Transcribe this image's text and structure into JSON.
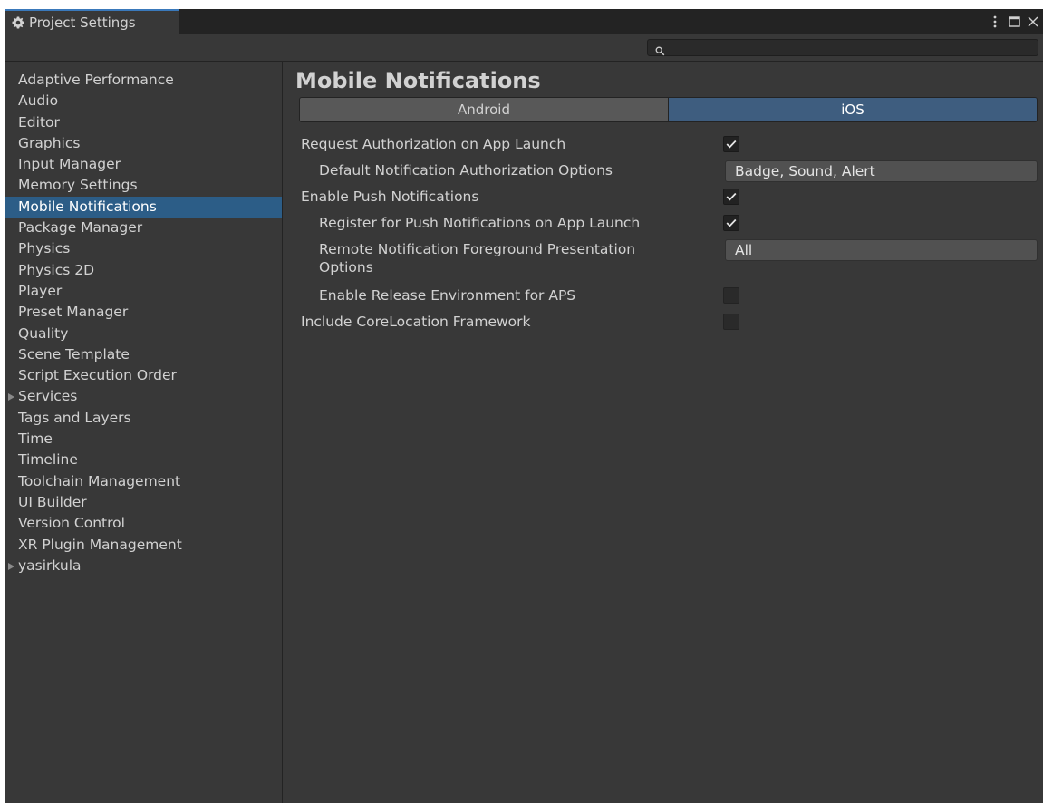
{
  "window": {
    "tab_title": "Project Settings",
    "tab_icon": "gear-icon"
  },
  "search": {
    "value": "",
    "placeholder": ""
  },
  "sidebar": {
    "items": [
      {
        "label": "Adaptive Performance"
      },
      {
        "label": "Audio"
      },
      {
        "label": "Editor"
      },
      {
        "label": "Graphics"
      },
      {
        "label": "Input Manager"
      },
      {
        "label": "Memory Settings"
      },
      {
        "label": "Mobile Notifications",
        "selected": true
      },
      {
        "label": "Package Manager"
      },
      {
        "label": "Physics"
      },
      {
        "label": "Physics 2D"
      },
      {
        "label": "Player"
      },
      {
        "label": "Preset Manager"
      },
      {
        "label": "Quality"
      },
      {
        "label": "Scene Template"
      },
      {
        "label": "Script Execution Order"
      },
      {
        "label": "Services",
        "foldout": true
      },
      {
        "label": "Tags and Layers"
      },
      {
        "label": "Time"
      },
      {
        "label": "Timeline"
      },
      {
        "label": "Toolchain Management"
      },
      {
        "label": "UI Builder"
      },
      {
        "label": "Version Control"
      },
      {
        "label": "XR Plugin Management"
      },
      {
        "label": "yasirkula",
        "foldout": true
      }
    ]
  },
  "main": {
    "title": "Mobile Notifications",
    "tabs": [
      {
        "label": "Android",
        "active": false
      },
      {
        "label": "iOS",
        "active": true
      }
    ],
    "settings": [
      {
        "label": "Request Authorization on App Launch",
        "type": "checkbox",
        "checked": true
      },
      {
        "label": "Default Notification Authorization Options",
        "type": "dropdown",
        "value": "Badge, Sound, Alert"
      },
      {
        "label": "Enable Push Notifications",
        "type": "checkbox",
        "checked": true
      },
      {
        "label": "Register for Push Notifications on App Launch",
        "type": "checkbox",
        "checked": true
      },
      {
        "label": "Remote Notification Foreground Presentation Options",
        "type": "dropdown",
        "value": "All"
      },
      {
        "label": "Enable Release Environment for APS",
        "type": "checkbox",
        "checked": false
      },
      {
        "label": "Include CoreLocation Framework",
        "type": "checkbox",
        "checked": false
      }
    ]
  },
  "colors": {
    "background": "#383838",
    "selection": "#2c5d87",
    "active_tab": "#3e5d7f",
    "text": "#d2d2d2"
  }
}
